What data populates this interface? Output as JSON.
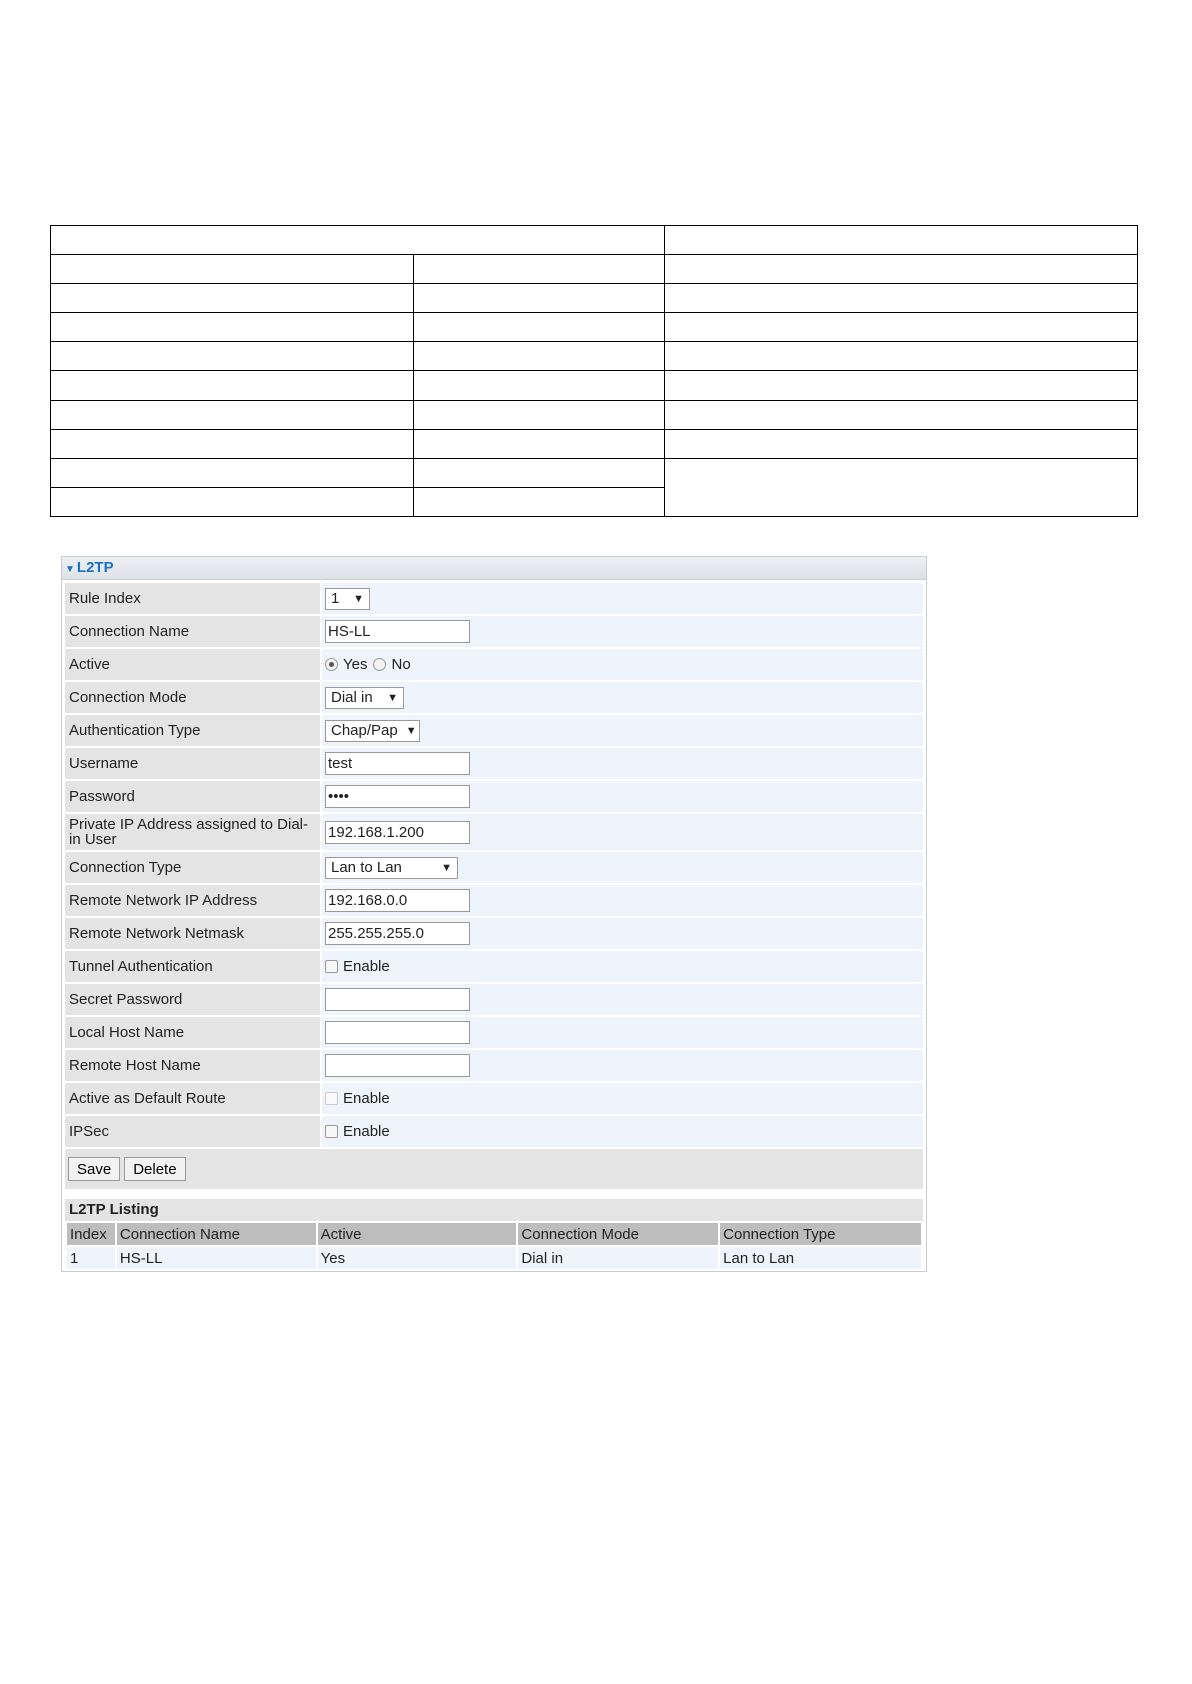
{
  "panel": {
    "title": "L2TP"
  },
  "form": {
    "rule_index": {
      "label": "Rule Index",
      "value": "1"
    },
    "connection_name": {
      "label": "Connection Name",
      "value": "HS-LL"
    },
    "active": {
      "label": "Active",
      "yes": "Yes",
      "no": "No",
      "selected": "Yes"
    },
    "connection_mode": {
      "label": "Connection Mode",
      "value": "Dial in"
    },
    "authentication_type": {
      "label": "Authentication Type",
      "value": "Chap/Pap"
    },
    "username": {
      "label": "Username",
      "value": "test"
    },
    "password": {
      "label": "Password",
      "value": "••••"
    },
    "private_ip": {
      "label": "Private IP Address assigned to Dial-in User",
      "value": "192.168.1.200"
    },
    "connection_type": {
      "label": "Connection Type",
      "value": "Lan to Lan"
    },
    "remote_ip": {
      "label": "Remote Network IP Address",
      "value": "192.168.0.0"
    },
    "remote_netmask": {
      "label": "Remote Network Netmask",
      "value": "255.255.255.0"
    },
    "tunnel_auth": {
      "label": "Tunnel Authentication",
      "option": "Enable",
      "checked": false
    },
    "secret_password": {
      "label": "Secret Password",
      "value": ""
    },
    "local_host_name": {
      "label": "Local Host Name",
      "value": ""
    },
    "remote_host_name": {
      "label": "Remote Host Name",
      "value": ""
    },
    "default_route": {
      "label": "Active as Default Route",
      "option": "Enable",
      "checked": false,
      "disabled": true
    },
    "ipsec": {
      "label": "IPSec",
      "option": "Enable",
      "checked": false
    }
  },
  "buttons": {
    "save": "Save",
    "delete": "Delete"
  },
  "listing": {
    "title": "L2TP Listing",
    "columns": [
      "Index",
      "Connection Name",
      "Active",
      "Connection Mode",
      "Connection Type"
    ],
    "rows": [
      [
        "1",
        "HS-LL",
        "Yes",
        "Dial in",
        "Lan to Lan"
      ]
    ]
  }
}
